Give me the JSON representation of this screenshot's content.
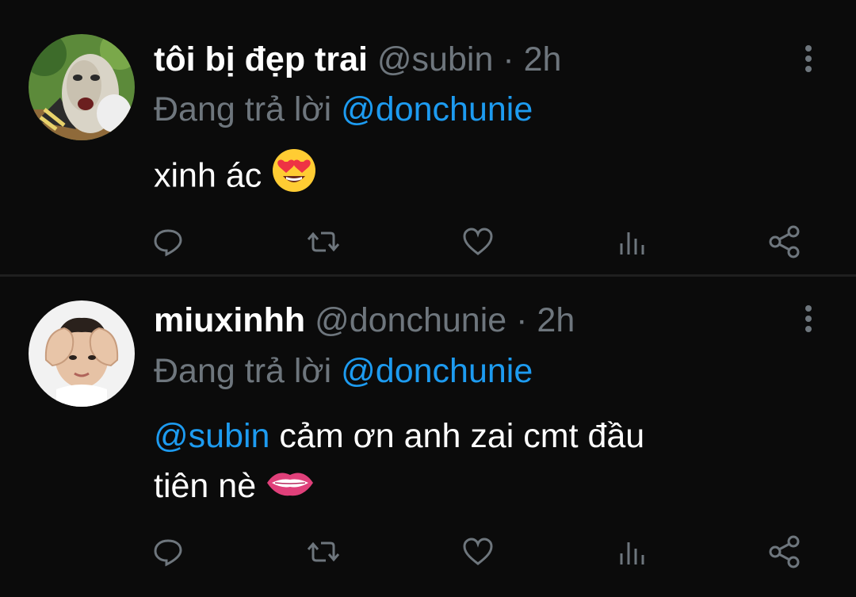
{
  "tweets": [
    {
      "display_name": "tôi bị đẹp trai",
      "handle": "@subin",
      "separator": "·",
      "time": "2h",
      "reply_prefix": "Đang trả lời",
      "reply_to": "@donchunie",
      "body_text": "xinh ác",
      "emoji": "heart-eyes-emoji"
    },
    {
      "display_name": "miuxinhh",
      "handle": "@donchunie",
      "separator": "·",
      "time": "2h",
      "reply_prefix": "Đang trả lời",
      "reply_to": "@donchunie",
      "body_mention": "@subin",
      "body_text_line1": "cảm ơn anh zai cmt đầu",
      "body_text_line2": "tiên nè",
      "emoji": "lips-emoji"
    }
  ],
  "icons": [
    "reply-icon",
    "retweet-icon",
    "like-icon",
    "stats-icon",
    "share-icon",
    "more-icon"
  ],
  "colors": {
    "background": "#0b0b0b",
    "text": "#ffffff",
    "muted": "#6e767d",
    "link": "#1d9bf0"
  }
}
